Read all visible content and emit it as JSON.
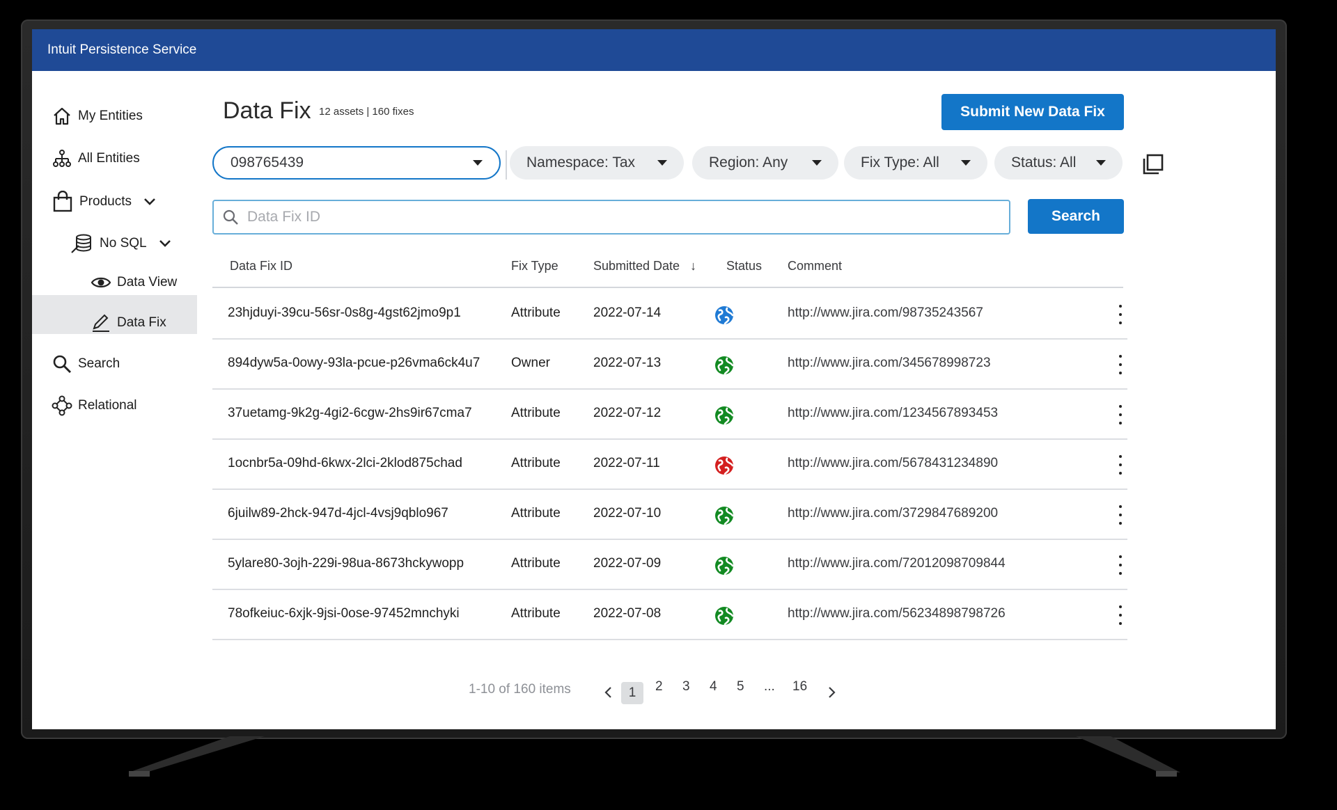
{
  "app": {
    "title": "Intuit Persistence Service"
  },
  "sidebar": {
    "items": [
      {
        "label": "My Entities",
        "icon": "home-icon"
      },
      {
        "label": "All Entities",
        "icon": "hierarchy-icon"
      },
      {
        "label": "Products",
        "icon": "shopping-bag-icon"
      },
      {
        "label": "No SQL",
        "icon": "database-icon"
      },
      {
        "label": "Data View",
        "icon": "eye-icon"
      },
      {
        "label": "Data Fix",
        "icon": "pencil-icon",
        "selected": true
      },
      {
        "label": "Search",
        "icon": "search-icon"
      },
      {
        "label": "Relational",
        "icon": "relational-icon"
      }
    ]
  },
  "header": {
    "title": "Data Fix",
    "subtitle": "12 assets | 160 fixes",
    "submit_label": "Submit New Data Fix"
  },
  "filters": {
    "account": "098765439",
    "namespace": "Namespace: Tax",
    "region": "Region: Any",
    "fix_type": "Fix Type: All",
    "status": "Status: All"
  },
  "search": {
    "placeholder": "Data Fix ID",
    "button_label": "Search"
  },
  "table": {
    "columns": [
      "Data Fix ID",
      "Fix Type",
      "Submitted Date",
      "Status",
      "Comment"
    ],
    "sort_indicator": "↓",
    "rows": [
      {
        "id": "23hjduyi-39cu-56sr-0s8g-4gst62jmo9p1",
        "fix_type": "Attribute",
        "date": "2022-07-14",
        "status": "blue",
        "comment": "http://www.jira.com/98735243567"
      },
      {
        "id": "894dyw5a-0owy-93la-pcue-p26vma6ck4u7",
        "fix_type": "Owner",
        "date": "2022-07-13",
        "status": "green",
        "comment": "http://www.jira.com/345678998723"
      },
      {
        "id": "37uetamg-9k2g-4gi2-6cgw-2hs9ir67cma7",
        "fix_type": "Attribute",
        "date": "2022-07-12",
        "status": "green",
        "comment": "http://www.jira.com/1234567893453"
      },
      {
        "id": "1ocnbr5a-09hd-6kwx-2lci-2klod875chad",
        "fix_type": "Attribute",
        "date": "2022-07-11",
        "status": "red",
        "comment": "http://www.jira.com/5678431234890"
      },
      {
        "id": "6juilw89-2hck-947d-4jcl-4vsj9qblo967",
        "fix_type": "Attribute",
        "date": "2022-07-10",
        "status": "green",
        "comment": "http://www.jira.com/3729847689200"
      },
      {
        "id": "5ylare80-3ojh-229i-98ua-8673hckywopp",
        "fix_type": "Attribute",
        "date": "2022-07-09",
        "status": "green",
        "comment": "http://www.jira.com/72012098709844"
      },
      {
        "id": "78ofkeiuc-6xjk-9jsi-0ose-97452mnchyki",
        "fix_type": "Attribute",
        "date": "2022-07-08",
        "status": "green",
        "comment": "http://www.jira.com/56234898798726"
      }
    ]
  },
  "status_colors": {
    "blue": "#1f7ad4",
    "green": "#128a22",
    "red": "#d41f1f"
  },
  "pagination": {
    "summary": "1-10 of 160 items",
    "pages": [
      "1",
      "2",
      "3",
      "4",
      "5",
      "...",
      "16"
    ],
    "current": "1"
  },
  "colors": {
    "brand": "#1f4a96",
    "accent": "#1376c8"
  }
}
